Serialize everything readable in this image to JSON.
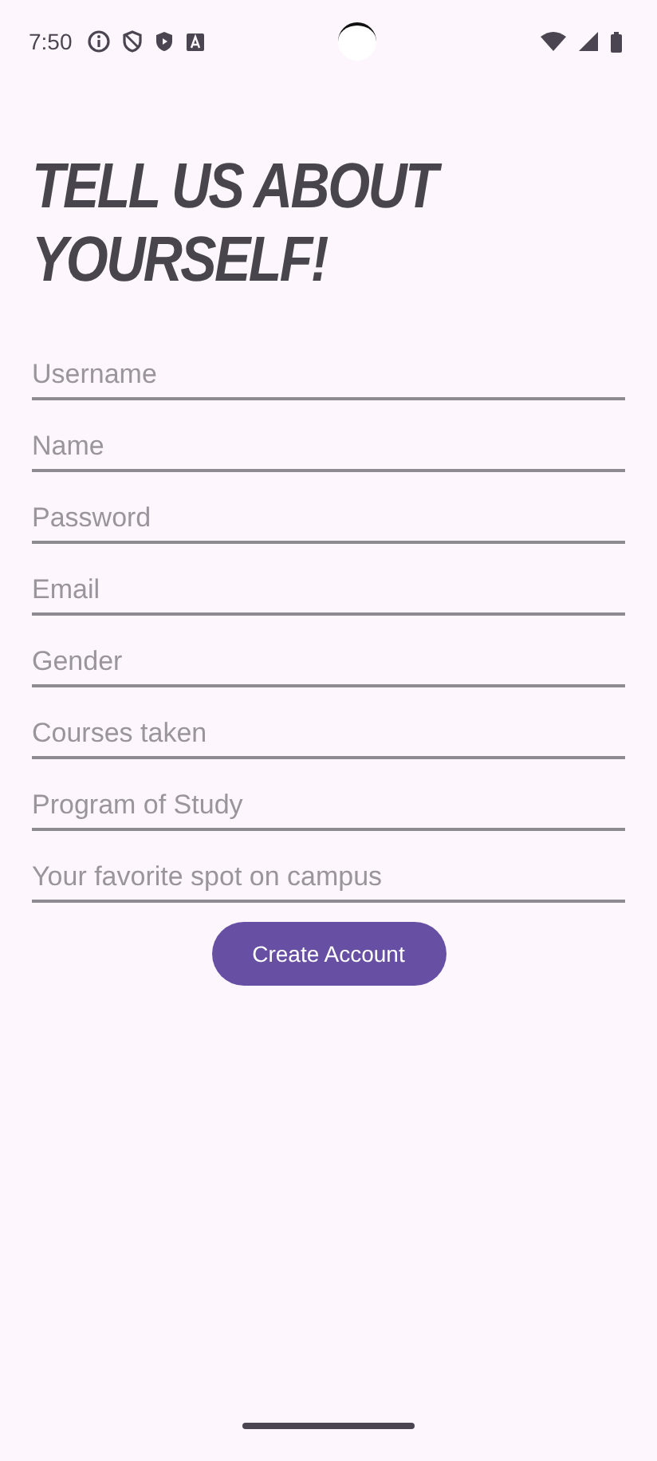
{
  "status_bar": {
    "time": "7:50"
  },
  "title": "TELL US ABOUT YOURSELF!",
  "fields": [
    {
      "placeholder": "Username"
    },
    {
      "placeholder": "Name"
    },
    {
      "placeholder": "Password"
    },
    {
      "placeholder": "Email"
    },
    {
      "placeholder": "Gender"
    },
    {
      "placeholder": "Courses taken"
    },
    {
      "placeholder": "Program of Study"
    },
    {
      "placeholder": "Your favorite spot on campus"
    }
  ],
  "button": "Create Account"
}
